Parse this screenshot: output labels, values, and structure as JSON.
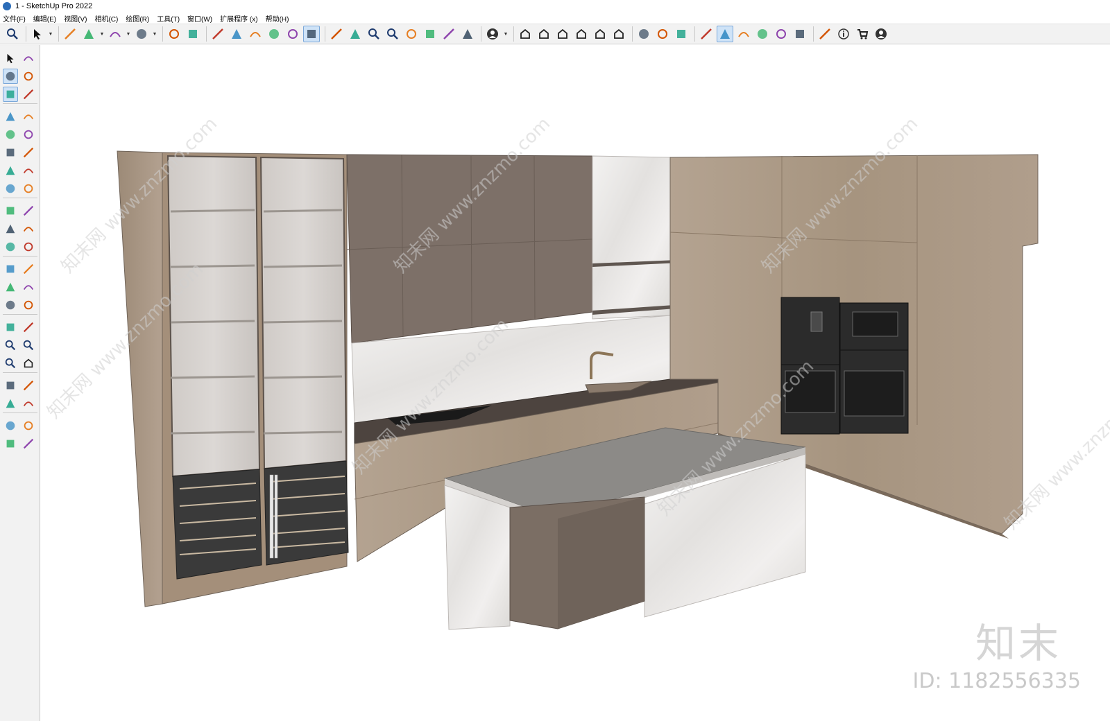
{
  "window": {
    "title": "1 - SketchUp Pro 2022"
  },
  "menubar": {
    "items": [
      "文件(F)",
      "编辑(E)",
      "视图(V)",
      "相机(C)",
      "绘图(R)",
      "工具(T)",
      "窗口(W)",
      "扩展程序 (x)",
      "帮助(H)"
    ]
  },
  "toolbar": {
    "icons": [
      "search-icon",
      "select-icon",
      "eraser-icon",
      "line-icon",
      "arc-icon",
      "rectangle-icon",
      "push-pull-icon",
      "follow-me-icon",
      "move-icon",
      "rotate-icon",
      "scale-icon",
      "tape-measure-icon",
      "text-icon",
      "paint-bucket-icon",
      "orbit-icon",
      "pan-icon",
      "zoom-icon",
      "zoom-extents-icon",
      "warehouse-icon",
      "tags-icon",
      "layers-icon",
      "sandbox-icon",
      "user-icon",
      "iso-view-icon",
      "front-view-icon",
      "top-view-icon",
      "right-view-icon",
      "back-view-icon",
      "left-view-icon",
      "section-plane-icon",
      "display-section-icon",
      "section-cut-icon",
      "add-location-icon",
      "shadows-icon",
      "fog-icon",
      "styles-icon",
      "cloud-icon",
      "settings-icon",
      "outliner-icon",
      "info-icon",
      "cart-icon",
      "account-icon"
    ]
  },
  "sidebar": {
    "icons": [
      "select-icon",
      "orbit-icon",
      "paint-bucket-icon",
      "eraser-icon",
      "component-icon",
      "tape-icon",
      "pencil-icon",
      "freehand-icon",
      "rectangle-icon",
      "rotated-rectangle-icon",
      "circle-icon",
      "polygon-icon",
      "arc-icon",
      "pie-icon",
      "3pt-arc-icon",
      "2pt-arc-icon",
      "move-icon",
      "push-pull-icon",
      "rotate-icon",
      "follow-me-icon",
      "scale-icon",
      "offset-icon",
      "tape-measure-icon",
      "dimension-icon",
      "protractor-icon",
      "text-icon",
      "axes-icon",
      "3d-text-icon",
      "orbit-2-icon",
      "pan-icon",
      "zoom-icon",
      "zoom-window-icon",
      "zoom-extents-icon",
      "previous-view-icon",
      "position-camera-icon",
      "look-around-icon",
      "walk-icon",
      "section-plane-icon",
      "warehouse-icon",
      "extension-icon",
      "layers-icon",
      "sandbox-icon"
    ]
  },
  "viewport": {
    "model": "kitchen-cabinet-model",
    "watermark_brand": "知末",
    "watermark_id": "ID: 1182556335",
    "watermark_tile": "知末网 www.znzmo.com"
  },
  "colors": {
    "wood": "#a89684",
    "wood_dark": "#8f7d6b",
    "upper_cabinet": "#7b6e64",
    "marble": "#eeeceb",
    "countertop": "#4e4540",
    "island_top": "#8b8986",
    "appliance": "#2b2b2b",
    "selected_blue": "#cfe3f7"
  }
}
